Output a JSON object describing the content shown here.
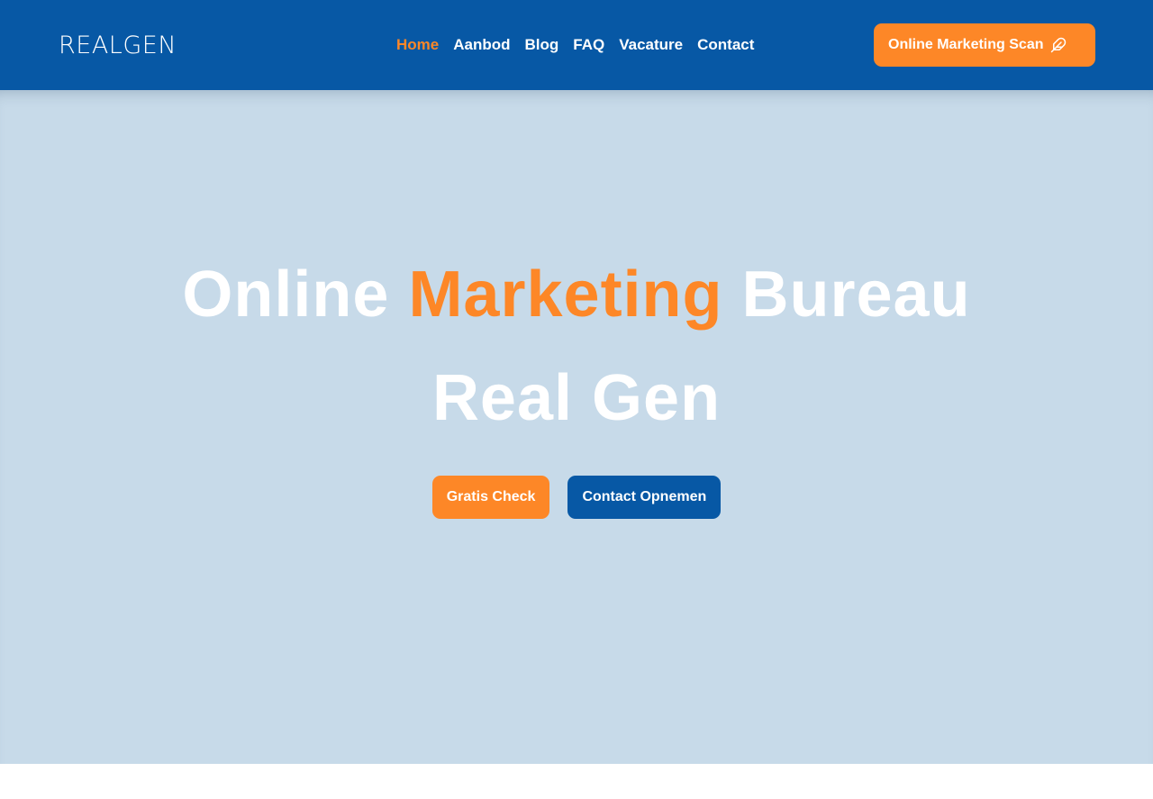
{
  "header": {
    "logo_text": "REALGEN",
    "nav": [
      {
        "label": "Home",
        "active": true
      },
      {
        "label": "Aanbod",
        "active": false
      },
      {
        "label": "Blog",
        "active": false
      },
      {
        "label": "FAQ",
        "active": false
      },
      {
        "label": "Vacature",
        "active": false
      },
      {
        "label": "Contact",
        "active": false
      }
    ],
    "cta_label": "Online Marketing Scan",
    "cta_icon": "feather-icon"
  },
  "hero": {
    "title_part1": "Online ",
    "title_accent": "Marketing",
    "title_part2": " Bureau",
    "title_line2": "Real Gen",
    "primary_button": "Gratis Check",
    "secondary_button": "Contact Opnemen"
  },
  "colors": {
    "brand_blue": "#0758a5",
    "accent_orange": "#fd8727",
    "hero_background": "#c7dae9",
    "text_white": "#ffffff"
  }
}
